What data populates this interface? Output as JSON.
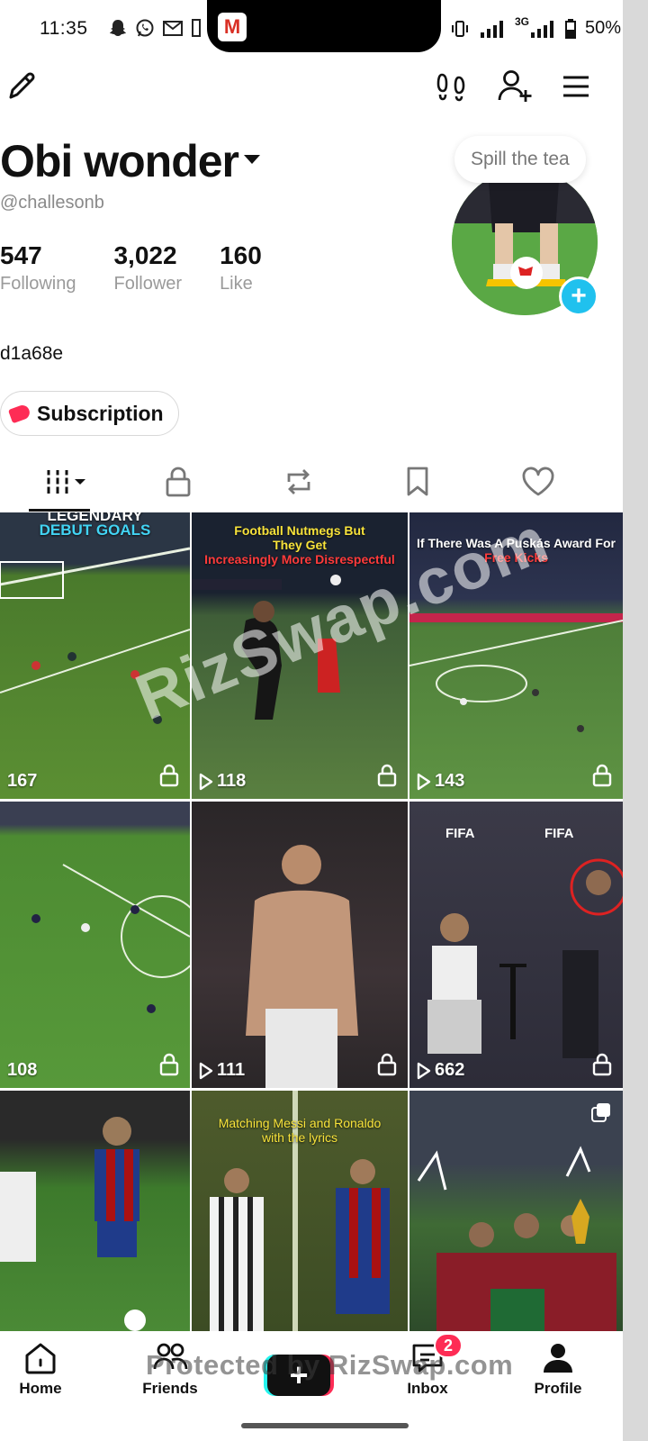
{
  "status_bar": {
    "time": "11:35",
    "left_icons": [
      "snapchat-icon",
      "whatsapp-icon",
      "gmail-icon",
      "sim-icon"
    ],
    "gmail_glyph": "M",
    "network": "3G",
    "battery": "50%"
  },
  "top_bar": {
    "icons": [
      "edit-icon",
      "footprints-icon",
      "add-friend-icon",
      "menu-icon"
    ]
  },
  "profile": {
    "name": "Obi wonder",
    "handle": "@challesonb",
    "stats": [
      {
        "value": "547",
        "label": "Following"
      },
      {
        "value": "3,022",
        "label": "Follower"
      },
      {
        "value": "160",
        "label": "Like"
      }
    ],
    "bio": "d1a68e",
    "subscription_label": "Subscription",
    "tooltip": "Spill the tea",
    "avatar_add": "+"
  },
  "tabs": [
    "videos-tab",
    "private-tab",
    "reposts-tab",
    "favorites-tab",
    "liked-tab"
  ],
  "grid": {
    "tiles": [
      {
        "views": "167",
        "caption_top": "LEGENDARY",
        "caption_bottom": "DEBUT GOALS",
        "locked": true,
        "play_icon": false,
        "bg": "green"
      },
      {
        "views": "118",
        "caption_top": "Football Nutmegs But They Get",
        "caption_bottom": "Increasingly More Disrespectful",
        "locked": true,
        "play_icon": true,
        "bg": "stadium"
      },
      {
        "views": "143",
        "caption_top": "If There Was A Puskás Award For",
        "caption_bottom": "Free Kicks",
        "locked": true,
        "play_icon": true,
        "bg": "stadium"
      },
      {
        "views": "108",
        "caption_top": "",
        "caption_bottom": "",
        "locked": true,
        "play_icon": false,
        "bg": "green"
      },
      {
        "views": "111",
        "caption_top": "",
        "caption_bottom": "",
        "locked": true,
        "play_icon": true,
        "bg": "dark"
      },
      {
        "views": "662",
        "caption_top": "",
        "caption_bottom": "",
        "locked": true,
        "play_icon": true,
        "bg": "ballon"
      },
      {
        "views": "",
        "caption_top": "",
        "caption_bottom": "",
        "locked": false,
        "play_icon": false,
        "bg": "green"
      },
      {
        "views": "",
        "caption_top": "Matching Messi and Ronaldo with the lyrics",
        "caption_bottom": "",
        "locked": false,
        "play_icon": false,
        "bg": "olive"
      },
      {
        "views": "",
        "caption_top": "",
        "caption_bottom": "",
        "locked": false,
        "play_icon": false,
        "bg": "crowd"
      }
    ]
  },
  "watermark": "RizSwap.com",
  "bottom_nav": {
    "items": [
      "Home",
      "Friends",
      "",
      "Inbox",
      "Profile"
    ],
    "inbox_badge": "2",
    "protected_text": "Protected by RizSwap.com"
  },
  "colors": {
    "accent": "#fe2c55",
    "cyan": "#25f4ee",
    "avatar_add": "#20c1ee"
  }
}
